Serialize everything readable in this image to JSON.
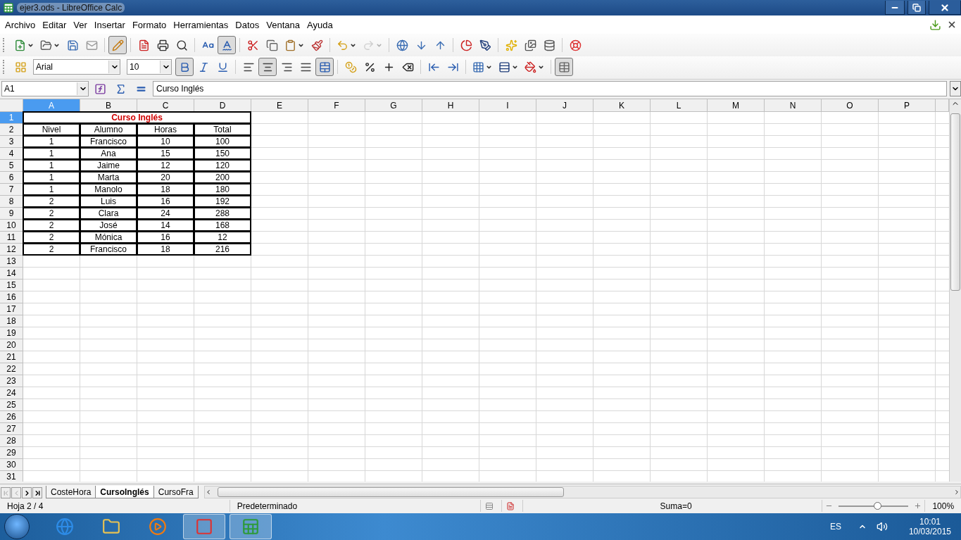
{
  "window": {
    "title": "ejer3.ods - LibreOffice Calc"
  },
  "menu": [
    {
      "label": "Archivo"
    },
    {
      "label": "Editar"
    },
    {
      "label": "Ver"
    },
    {
      "label": "Insertar"
    },
    {
      "label": "Formato"
    },
    {
      "label": "Herramientas"
    },
    {
      "label": "Datos"
    },
    {
      "label": "Ventana"
    },
    {
      "label": "Ayuda"
    }
  ],
  "toolbars": [
    {
      "items": [
        {
          "kind": "new",
          "pressed": false,
          "disabled": false,
          "dropdown": true
        },
        {
          "kind": "open",
          "pressed": false,
          "disabled": false,
          "dropdown": true
        },
        {
          "kind": "save",
          "pressed": false,
          "disabled": false,
          "dropdown": false
        },
        {
          "kind": "email",
          "pressed": false,
          "disabled": false,
          "dropdown": false
        },
        {
          "kind": "separator"
        },
        {
          "kind": "edit",
          "pressed": true,
          "disabled": false,
          "dropdown": false
        },
        {
          "kind": "separator"
        },
        {
          "kind": "pdf",
          "pressed": false,
          "disabled": false,
          "dropdown": false
        },
        {
          "kind": "print",
          "pressed": false,
          "disabled": false,
          "dropdown": false
        },
        {
          "kind": "preview",
          "pressed": false,
          "disabled": false,
          "dropdown": false
        },
        {
          "kind": "separator"
        },
        {
          "kind": "spellcheck",
          "pressed": false,
          "disabled": false,
          "dropdown": false
        },
        {
          "kind": "autospell",
          "pressed": true,
          "disabled": false,
          "dropdown": false
        },
        {
          "kind": "separator"
        },
        {
          "kind": "cut",
          "pressed": false,
          "disabled": false,
          "dropdown": false
        },
        {
          "kind": "copy",
          "pressed": false,
          "disabled": false,
          "dropdown": false
        },
        {
          "kind": "paste",
          "pressed": false,
          "disabled": false,
          "dropdown": true
        },
        {
          "kind": "clone",
          "pressed": false,
          "disabled": false,
          "dropdown": false
        },
        {
          "kind": "separator"
        },
        {
          "kind": "undo",
          "pressed": false,
          "disabled": false,
          "dropdown": true
        },
        {
          "kind": "redo",
          "pressed": false,
          "disabled": true,
          "dropdown": true
        },
        {
          "kind": "separator"
        },
        {
          "kind": "hyperlink",
          "pressed": false,
          "disabled": false,
          "dropdown": false
        },
        {
          "kind": "sort_asc",
          "pressed": false,
          "disabled": false,
          "dropdown": false
        },
        {
          "kind": "sort_desc",
          "pressed": false,
          "disabled": false,
          "dropdown": false
        },
        {
          "kind": "separator"
        },
        {
          "kind": "chart",
          "pressed": false,
          "disabled": false,
          "dropdown": false
        },
        {
          "kind": "draw",
          "pressed": false,
          "disabled": false,
          "dropdown": false
        },
        {
          "kind": "separator"
        },
        {
          "kind": "navigator",
          "pressed": false,
          "disabled": false,
          "dropdown": false
        },
        {
          "kind": "gallery",
          "pressed": false,
          "disabled": false,
          "dropdown": false
        },
        {
          "kind": "datasource",
          "pressed": false,
          "disabled": false,
          "dropdown": false
        },
        {
          "kind": "separator"
        },
        {
          "kind": "help",
          "pressed": false,
          "disabled": false,
          "dropdown": false
        }
      ]
    },
    {
      "items": [
        {
          "kind": "styles",
          "pressed": false,
          "disabled": false,
          "dropdown": false
        },
        {
          "kind": "font_name",
          "value": "Arial"
        },
        {
          "kind": "font_size",
          "value": "10"
        },
        {
          "kind": "bold",
          "pressed": true,
          "disabled": false,
          "dropdown": false
        },
        {
          "kind": "italic",
          "pressed": false,
          "disabled": false,
          "dropdown": false
        },
        {
          "kind": "underline",
          "pressed": false,
          "disabled": false,
          "dropdown": false
        },
        {
          "kind": "separator"
        },
        {
          "kind": "align_left",
          "pressed": false,
          "disabled": false,
          "dropdown": false
        },
        {
          "kind": "align_center",
          "pressed": true,
          "disabled": false,
          "dropdown": false
        },
        {
          "kind": "align_right",
          "pressed": false,
          "disabled": false,
          "dropdown": false
        },
        {
          "kind": "justify",
          "pressed": false,
          "disabled": false,
          "dropdown": false
        },
        {
          "kind": "merge",
          "pressed": true,
          "disabled": false,
          "dropdown": false
        },
        {
          "kind": "separator"
        },
        {
          "kind": "currency",
          "pressed": false,
          "disabled": false,
          "dropdown": false
        },
        {
          "kind": "percent",
          "pressed": false,
          "disabled": false,
          "dropdown": false
        },
        {
          "kind": "add_decimal",
          "pressed": false,
          "disabled": false,
          "dropdown": false
        },
        {
          "kind": "delete_decimal",
          "pressed": false,
          "disabled": false,
          "dropdown": false
        },
        {
          "kind": "separator"
        },
        {
          "kind": "indent_decrease",
          "pressed": false,
          "disabled": false,
          "dropdown": false
        },
        {
          "kind": "indent_increase",
          "pressed": false,
          "disabled": false,
          "dropdown": false
        },
        {
          "kind": "separator"
        },
        {
          "kind": "borders",
          "pressed": false,
          "disabled": false,
          "dropdown": true
        },
        {
          "kind": "border_style",
          "pressed": false,
          "disabled": false,
          "dropdown": true
        },
        {
          "kind": "background",
          "pressed": false,
          "disabled": false,
          "dropdown": true
        },
        {
          "kind": "separator"
        },
        {
          "kind": "gridlines",
          "pressed": true,
          "disabled": false,
          "dropdown": false
        }
      ]
    }
  ],
  "formula_bar": {
    "name_box": "A1",
    "formula": "Curso Inglés"
  },
  "sheet": {
    "columns": [
      {
        "label": "A",
        "selected": true
      },
      {
        "label": "B",
        "selected": false
      },
      {
        "label": "C",
        "selected": false
      },
      {
        "label": "D",
        "selected": false
      },
      {
        "label": "E",
        "selected": false
      },
      {
        "label": "F",
        "selected": false
      },
      {
        "label": "G",
        "selected": false
      },
      {
        "label": "H",
        "selected": false
      },
      {
        "label": "I",
        "selected": false
      },
      {
        "label": "J",
        "selected": false
      },
      {
        "label": "K",
        "selected": false
      },
      {
        "label": "L",
        "selected": false
      },
      {
        "label": "M",
        "selected": false
      },
      {
        "label": "N",
        "selected": false
      },
      {
        "label": "O",
        "selected": false
      },
      {
        "label": "P",
        "selected": false
      }
    ],
    "rows": [
      {
        "label": "1",
        "selected": true
      },
      {
        "label": "2",
        "selected": false
      },
      {
        "label": "3",
        "selected": false
      },
      {
        "label": "4",
        "selected": false
      },
      {
        "label": "5",
        "selected": false
      },
      {
        "label": "6",
        "selected": false
      },
      {
        "label": "7",
        "selected": false
      },
      {
        "label": "8",
        "selected": false
      },
      {
        "label": "9",
        "selected": false
      },
      {
        "label": "10",
        "selected": false
      },
      {
        "label": "11",
        "selected": false
      },
      {
        "label": "12",
        "selected": false
      },
      {
        "label": "13",
        "selected": false
      },
      {
        "label": "14",
        "selected": false
      },
      {
        "label": "15",
        "selected": false
      },
      {
        "label": "16",
        "selected": false
      },
      {
        "label": "17",
        "selected": false
      },
      {
        "label": "18",
        "selected": false
      },
      {
        "label": "19",
        "selected": false
      },
      {
        "label": "20",
        "selected": false
      },
      {
        "label": "21",
        "selected": false
      },
      {
        "label": "22",
        "selected": false
      },
      {
        "label": "23",
        "selected": false
      },
      {
        "label": "24",
        "selected": false
      },
      {
        "label": "25",
        "selected": false
      },
      {
        "label": "26",
        "selected": false
      },
      {
        "label": "27",
        "selected": false
      },
      {
        "label": "28",
        "selected": false
      },
      {
        "label": "29",
        "selected": false
      },
      {
        "label": "30",
        "selected": false
      },
      {
        "label": "31",
        "selected": false
      }
    ],
    "table": {
      "title": "Curso Inglés",
      "header": [
        "Nivel",
        "Alumno",
        "Horas",
        "Total"
      ],
      "rows": [
        [
          "1",
          "Francisco",
          "10",
          "100"
        ],
        [
          "1",
          "Ana",
          "15",
          "150"
        ],
        [
          "1",
          "Jaime",
          "12",
          "120"
        ],
        [
          "1",
          "Marta",
          "20",
          "200"
        ],
        [
          "1",
          "Manolo",
          "18",
          "180"
        ],
        [
          "2",
          "Luis",
          "16",
          "192"
        ],
        [
          "2",
          "Clara",
          "24",
          "288"
        ],
        [
          "2",
          "José",
          "14",
          "168"
        ],
        [
          "2",
          "Mónica",
          "16",
          "12"
        ],
        [
          "2",
          "Francisco",
          "18",
          "216"
        ]
      ]
    }
  },
  "sheet_tabs": [
    {
      "label": "CosteHora",
      "selected": false
    },
    {
      "label": "CursoInglés",
      "selected": true
    },
    {
      "label": "CursoFra",
      "selected": false
    }
  ],
  "status_bar": {
    "sheet": "Hoja 2 / 4",
    "page_style": "Predeterminado",
    "sum": "Suma=0",
    "zoom": {
      "level": 0.55,
      "reading": "100%"
    }
  },
  "taskbar": {
    "apps": [
      {
        "kind": "browser_e",
        "running": false
      },
      {
        "kind": "files",
        "running": false
      },
      {
        "kind": "media",
        "running": false
      },
      {
        "kind": "chrome",
        "running": true
      },
      {
        "kind": "calc",
        "running": true
      }
    ],
    "language": "ES",
    "time": "10:01",
    "date": "10/03/2015"
  }
}
